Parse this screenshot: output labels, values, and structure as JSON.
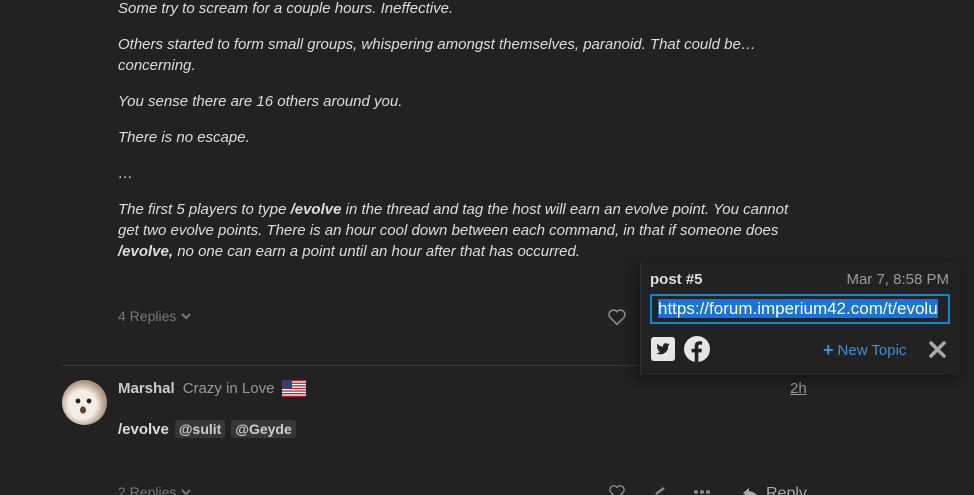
{
  "post": {
    "para1": "Some try to scream for a couple hours. Ineffective.",
    "para2": "Others started to form small groups, whispering amongst themselves, paranoid. That could be… concerning.",
    "para3": "You sense there are 16 others around you.",
    "para4": "There is no escape.",
    "para5": "…",
    "rules_a": "The first 5 players to type ",
    "rules_b": "/evolve",
    "rules_c": " in the thread and tag the host will earn an evolve point. You cannot get two evolve points. There is an hour cool down between each command, in that if someone does ",
    "rules_d": "/evolve,",
    "rules_e": " no one can earn a point until an hour after that has occurred.",
    "replies": "4 Replies"
  },
  "share_popup": {
    "title": "post #5",
    "date": "Mar 7, 8:58 PM",
    "link": "https://forum.imperium42.com/t/evolu",
    "new_topic": "New Topic"
  },
  "reply_post": {
    "username": "Marshal",
    "user_title": "Crazy in Love",
    "time": "2h",
    "command": "/evolve",
    "mention1": "@sulit",
    "mention2": "@Geyde",
    "replies": "2 Replies",
    "reply_label": "Reply"
  },
  "colors": {
    "background": "#222222",
    "accent": "#0c89d6",
    "link": "#3b8fd6"
  }
}
